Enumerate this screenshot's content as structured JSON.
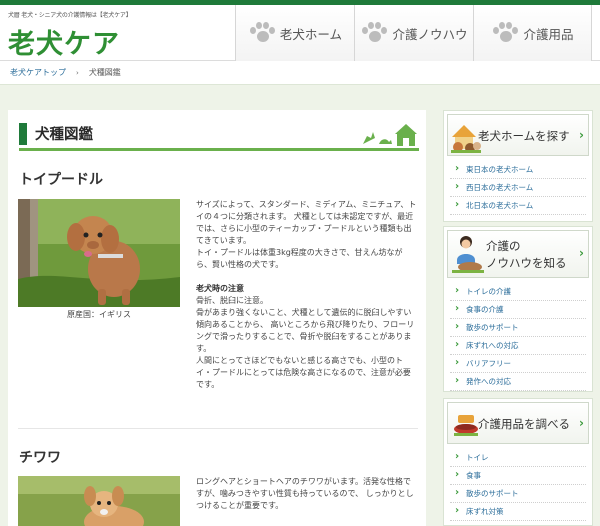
{
  "header": {
    "tagline": "犬暦 老犬・シニア犬の介護情報は【老犬ケア】",
    "logo": "老犬ケア",
    "nav": [
      {
        "label": "老犬ホーム",
        "icon": "paw-icon"
      },
      {
        "label": "介護ノウハウ",
        "icon": "paw-icon"
      },
      {
        "label": "介護用品",
        "icon": "paw-icon"
      }
    ]
  },
  "breadcrumb": {
    "home": "老犬ケアトップ",
    "separator": "›",
    "current": "犬種図鑑"
  },
  "main": {
    "title": "犬種図鑑",
    "breeds": [
      {
        "name": "トイプードル",
        "caption": "原産国：イギリス",
        "description": [
          "サイズによって、スタンダード、ミディアム、ミニチュア、トイの４つに分類されます。 犬種としては未認定ですが、最近では、さらに小型のティーカップ・プードルという種類も出てきています。",
          "トイ・プードルは体重3kg程度の大きさで、甘えん坊ながら、賢い性格の犬です。"
        ],
        "note_title": "老犬時の注意",
        "note": [
          "骨折、脱臼に注意。",
          "骨があまり強くないこと、犬種として遺伝的に脱臼しやすい傾向あることから、 高いところから飛び降りたり、フローリングで滑ったりすることで、骨折や脱臼をすることがあります。",
          "人間にとってさほどでもないと感じる高さでも、小型のトイ・プードルにとっては危険な高さになるので、注意が必要です。"
        ]
      },
      {
        "name": "チワワ",
        "description": [
          "ロングヘアとショートヘアのチワワがいます。活発な性格ですが、噛みつきやすい性質も持っているので、 しっかりとしつけることが重要です。"
        ]
      }
    ]
  },
  "sidebar": {
    "boxes": [
      {
        "title": "老犬ホームを探す",
        "items": [
          "東日本の老犬ホーム",
          "西日本の老犬ホーム",
          "北日本の老犬ホーム"
        ]
      },
      {
        "title_line1": "介護の",
        "title_line2": "ノウハウを知る",
        "items": [
          "トイレの介護",
          "食事の介護",
          "散歩のサポート",
          "床ずれへの対応",
          "バリアフリー",
          "発作への対応"
        ]
      },
      {
        "title": "介護用品を調べる",
        "items": [
          "トイレ",
          "食事",
          "散歩のサポート",
          "床ずれ対策"
        ]
      }
    ]
  },
  "colors": {
    "brand_green": "#1f7a3a",
    "logo_green": "#2f8f34",
    "link_blue": "#2b6d9a",
    "accent_line": "#6ab04c"
  }
}
